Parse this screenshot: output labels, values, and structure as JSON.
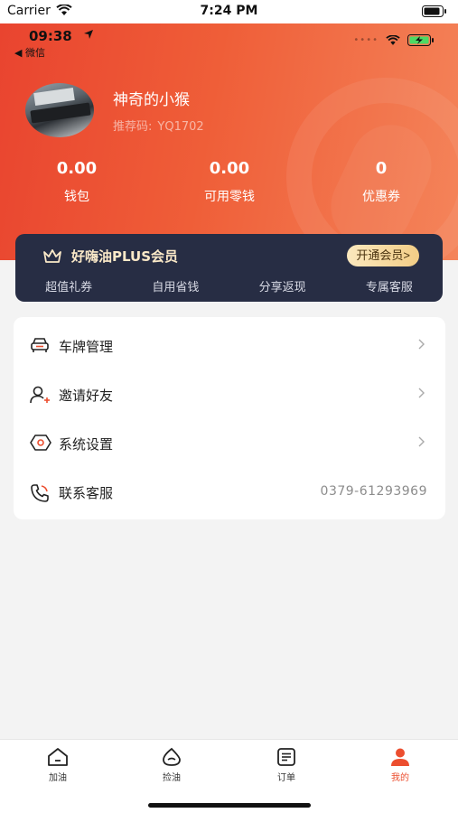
{
  "os_status": {
    "carrier": "Carrier",
    "time": "7:24 PM"
  },
  "app_status": {
    "time": "09:38",
    "back_label": "◀ 微信"
  },
  "profile": {
    "username": "神奇的小猴",
    "referral_label": "推荐码:",
    "referral_code": "YQ1702"
  },
  "stats": [
    {
      "value": "0.00",
      "label": "钱包"
    },
    {
      "value": "0.00",
      "label": "可用零钱"
    },
    {
      "value": "0",
      "label": "优惠券"
    }
  ],
  "vip": {
    "title": "好嗨油PLUS会员",
    "button": "开通会员>",
    "perks": [
      "超值礼券",
      "自用省钱",
      "分享返现",
      "专属客服"
    ]
  },
  "menu": {
    "plates": "车牌管理",
    "invite": "邀请好友",
    "settings": "系统设置",
    "service": "联系客服",
    "service_phone": "0379-61293969"
  },
  "tabs": [
    {
      "label": "加油",
      "icon": "home-icon"
    },
    {
      "label": "捡油",
      "icon": "drop-icon"
    },
    {
      "label": "订单",
      "icon": "list-icon"
    },
    {
      "label": "我的",
      "icon": "person-icon"
    }
  ],
  "colors": {
    "accent": "#ec4e2f",
    "vip_bg": "#272d44",
    "vip_gold": "#f2cd86"
  }
}
